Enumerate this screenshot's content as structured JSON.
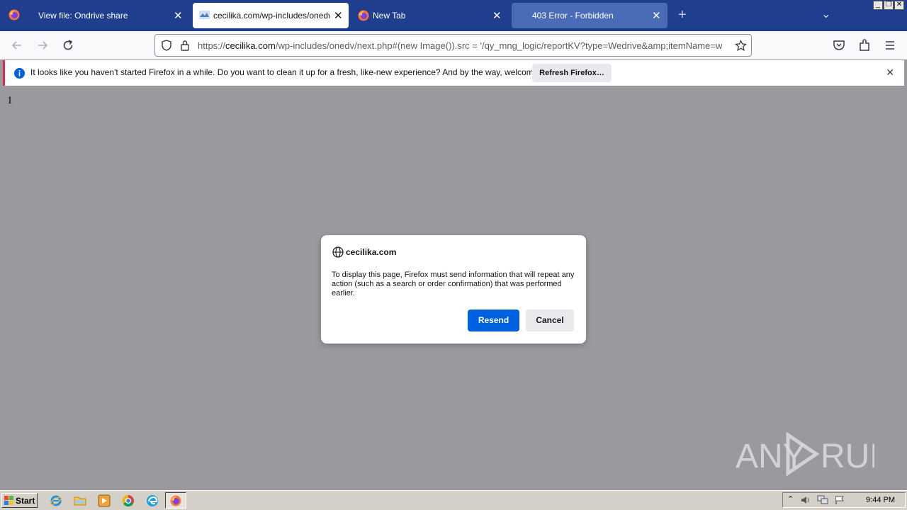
{
  "browser": {
    "tabs": [
      {
        "title": "View file: Ondrive share",
        "active": false
      },
      {
        "title": "cecilika.com/wp-includes/onedv/ne",
        "active": true
      },
      {
        "title": "New Tab",
        "active": false
      },
      {
        "title": "403 Error - Forbidden",
        "active": false
      }
    ],
    "new_tab_symbol": "+",
    "tab_list_symbol": "⌄",
    "window_buttons": {
      "minimize": "_",
      "restore": "❐",
      "close": "✕"
    },
    "url": {
      "scheme": "https://",
      "host": "cecilika.com",
      "rest": "/wp-includes/onedv/next.php#(new Image()).src = '/qy_mng_logic/reportKV?type=Wedrive&amp;itemName=w"
    }
  },
  "notification": {
    "message": "It looks like you haven't started Firefox in a while. Do you want to clean it up for a fresh, like-new experience? And by the way, welcome back!",
    "button_label": "Refresh Firefox…"
  },
  "page": {
    "text": "1"
  },
  "dialog": {
    "host": "cecilika.com",
    "message": "To display this page, Firefox must send information that will repeat any action (such as a search or order confirmation) that was performed earlier.",
    "resend_label": "Resend",
    "cancel_label": "Cancel"
  },
  "watermark": {
    "text": "ANY RUN"
  },
  "taskbar": {
    "start_label": "Start",
    "time": "9:44 PM",
    "pinned": [
      "internet-explorer-icon",
      "file-explorer-icon",
      "media-player-icon",
      "chrome-icon",
      "edge-icon",
      "firefox-icon"
    ]
  },
  "colors": {
    "accent": "#0061e0",
    "tabstrip": "#1f3f8e",
    "content_bg": "#9a999e"
  }
}
